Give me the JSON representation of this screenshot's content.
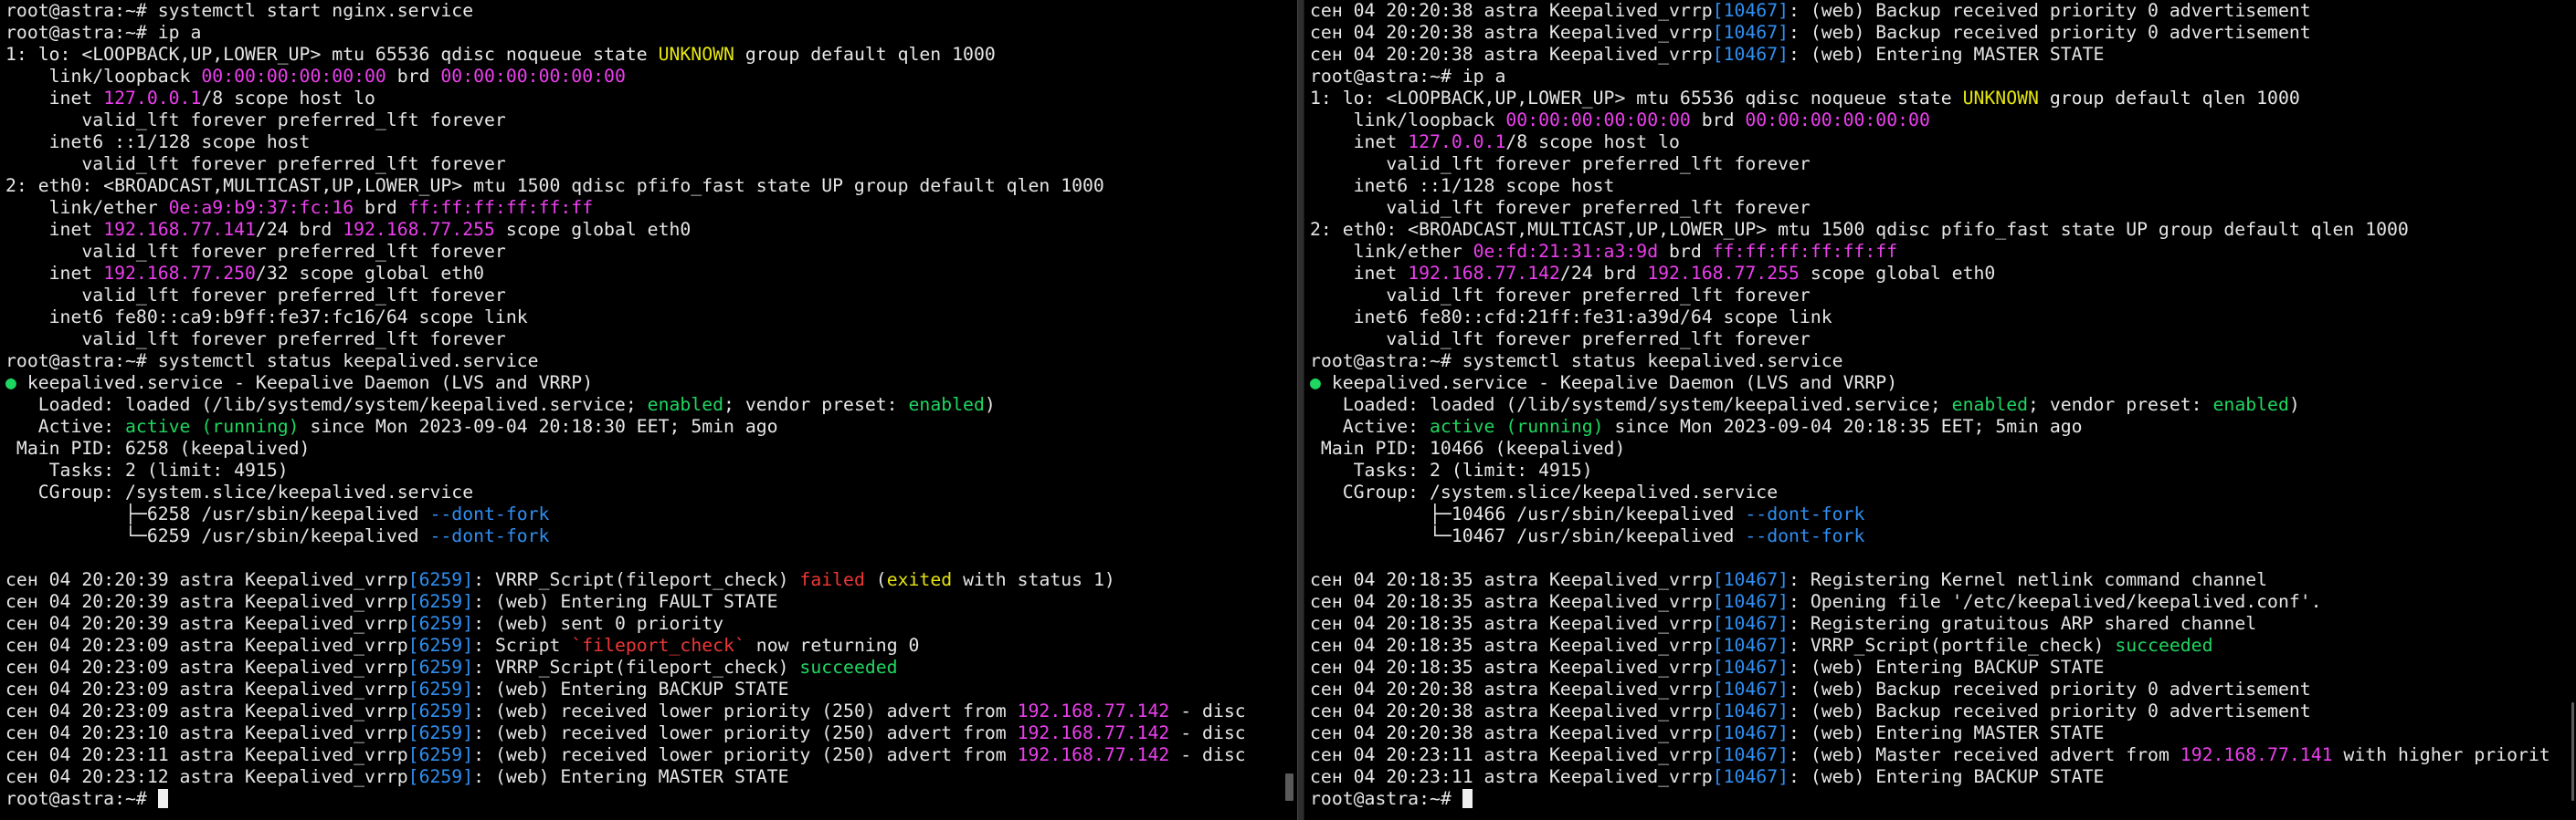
{
  "colors": {
    "default": "#e6e6e6",
    "magenta": "#ec3fee",
    "yellow": "#e5e510",
    "green": "#1ed760",
    "blue": "#2f8ff2",
    "red": "#f03636",
    "background": "#000000"
  },
  "left_pane": {
    "lines": [
      [
        [
          "d",
          "root@astra:~# systemctl start nginx.service"
        ]
      ],
      [
        [
          "d",
          "root@astra:~# ip a"
        ]
      ],
      [
        [
          "d",
          "1: lo: <LOOPBACK,UP,LOWER_UP> mtu 65536 qdisc noqueue state "
        ],
        [
          "y",
          "UNKNOWN"
        ],
        [
          "d",
          " group default qlen 1000"
        ]
      ],
      [
        [
          "d",
          "    link/loopback "
        ],
        [
          "m",
          "00:00:00:00:00:00"
        ],
        [
          "d",
          " brd "
        ],
        [
          "m",
          "00:00:00:00:00:00"
        ]
      ],
      [
        [
          "d",
          "    inet "
        ],
        [
          "m",
          "127.0.0.1"
        ],
        [
          "d",
          "/8 scope host lo"
        ]
      ],
      [
        [
          "d",
          "       valid_lft forever preferred_lft forever"
        ]
      ],
      [
        [
          "d",
          "    inet6 ::1/128 scope host"
        ]
      ],
      [
        [
          "d",
          "       valid_lft forever preferred_lft forever"
        ]
      ],
      [
        [
          "d",
          "2: eth0: <BROADCAST,MULTICAST,UP,LOWER_UP> mtu 1500 qdisc pfifo_fast state UP group default qlen 1000"
        ]
      ],
      [
        [
          "d",
          "    link/ether "
        ],
        [
          "m",
          "0e:a9:b9:37:fc:16"
        ],
        [
          "d",
          " brd "
        ],
        [
          "m",
          "ff:ff:ff:ff:ff:ff"
        ]
      ],
      [
        [
          "d",
          "    inet "
        ],
        [
          "m",
          "192.168.77.141"
        ],
        [
          "d",
          "/24 brd "
        ],
        [
          "m",
          "192.168.77.255"
        ],
        [
          "d",
          " scope global eth0"
        ]
      ],
      [
        [
          "d",
          "       valid_lft forever preferred_lft forever"
        ]
      ],
      [
        [
          "d",
          "    inet "
        ],
        [
          "m",
          "192.168.77.250"
        ],
        [
          "d",
          "/32 scope global eth0"
        ]
      ],
      [
        [
          "d",
          "       valid_lft forever preferred_lft forever"
        ]
      ],
      [
        [
          "d",
          "    inet6 fe80::ca9:b9ff:fe37:fc16/64 scope link"
        ]
      ],
      [
        [
          "d",
          "       valid_lft forever preferred_lft forever"
        ]
      ],
      [
        [
          "d",
          "root@astra:~# systemctl status keepalived.service"
        ]
      ],
      [
        [
          "g",
          "●"
        ],
        [
          "d",
          " keepalived.service - Keepalive Daemon (LVS and VRRP)"
        ]
      ],
      [
        [
          "d",
          "   Loaded: loaded (/lib/systemd/system/keepalived.service; "
        ],
        [
          "g",
          "enabled"
        ],
        [
          "d",
          "; vendor preset: "
        ],
        [
          "g",
          "enabled"
        ],
        [
          "d",
          ")"
        ]
      ],
      [
        [
          "d",
          "   Active: "
        ],
        [
          "g",
          "active (running)"
        ],
        [
          "d",
          " since Mon 2023-09-04 20:18:30 EET; 5min ago"
        ]
      ],
      [
        [
          "d",
          " Main PID: 6258 (keepalived)"
        ]
      ],
      [
        [
          "d",
          "    Tasks: 2 (limit: 4915)"
        ]
      ],
      [
        [
          "d",
          "   CGroup: /system.slice/keepalived.service"
        ]
      ],
      [
        [
          "d",
          "           ├─6258 /usr/sbin/keepalived "
        ],
        [
          "b",
          "--dont-fork"
        ]
      ],
      [
        [
          "d",
          "           └─6259 /usr/sbin/keepalived "
        ],
        [
          "b",
          "--dont-fork"
        ]
      ],
      [
        [
          "d",
          ""
        ]
      ],
      [
        [
          "d",
          "сен 04 20:20:39 astra Keepalived_vrrp"
        ],
        [
          "b",
          "[6259]"
        ],
        [
          "d",
          ": VRRP_Script(fileport_check) "
        ],
        [
          "r",
          "failed"
        ],
        [
          "d",
          " ("
        ],
        [
          "y",
          "exited"
        ],
        [
          "d",
          " with status 1)"
        ]
      ],
      [
        [
          "d",
          "сен 04 20:20:39 astra Keepalived_vrrp"
        ],
        [
          "b",
          "[6259]"
        ],
        [
          "d",
          ": (web) Entering FAULT STATE"
        ]
      ],
      [
        [
          "d",
          "сен 04 20:20:39 astra Keepalived_vrrp"
        ],
        [
          "b",
          "[6259]"
        ],
        [
          "d",
          ": (web) sent 0 priority"
        ]
      ],
      [
        [
          "d",
          "сен 04 20:23:09 astra Keepalived_vrrp"
        ],
        [
          "b",
          "[6259]"
        ],
        [
          "d",
          ": Script "
        ],
        [
          "r",
          "`fileport_check`"
        ],
        [
          "d",
          " now returning 0"
        ]
      ],
      [
        [
          "d",
          "сен 04 20:23:09 astra Keepalived_vrrp"
        ],
        [
          "b",
          "[6259]"
        ],
        [
          "d",
          ": VRRP_Script(fileport_check) "
        ],
        [
          "g",
          "succeeded"
        ]
      ],
      [
        [
          "d",
          "сен 04 20:23:09 astra Keepalived_vrrp"
        ],
        [
          "b",
          "[6259]"
        ],
        [
          "d",
          ": (web) Entering BACKUP STATE"
        ]
      ],
      [
        [
          "d",
          "сен 04 20:23:09 astra Keepalived_vrrp"
        ],
        [
          "b",
          "[6259]"
        ],
        [
          "d",
          ": (web) received lower priority (250) advert from "
        ],
        [
          "m",
          "192.168.77.142"
        ],
        [
          "d",
          " - disc"
        ]
      ],
      [
        [
          "d",
          "сен 04 20:23:10 astra Keepalived_vrrp"
        ],
        [
          "b",
          "[6259]"
        ],
        [
          "d",
          ": (web) received lower priority (250) advert from "
        ],
        [
          "m",
          "192.168.77.142"
        ],
        [
          "d",
          " - disc"
        ]
      ],
      [
        [
          "d",
          "сен 04 20:23:11 astra Keepalived_vrrp"
        ],
        [
          "b",
          "[6259]"
        ],
        [
          "d",
          ": (web) received lower priority (250) advert from "
        ],
        [
          "m",
          "192.168.77.142"
        ],
        [
          "d",
          " - disc"
        ]
      ],
      [
        [
          "d",
          "сен 04 20:23:12 astra Keepalived_vrrp"
        ],
        [
          "b",
          "[6259]"
        ],
        [
          "d",
          ": (web) Entering MASTER STATE"
        ]
      ],
      [
        [
          "d",
          "root@astra:~# "
        ],
        [
          "c",
          ""
        ]
      ]
    ]
  },
  "right_pane": {
    "lines": [
      [
        [
          "d",
          "сен 04 20:20:38 astra Keepalived_vrrp"
        ],
        [
          "b",
          "[10467]"
        ],
        [
          "d",
          ": (web) Backup received priority 0 advertisement"
        ]
      ],
      [
        [
          "d",
          "сен 04 20:20:38 astra Keepalived_vrrp"
        ],
        [
          "b",
          "[10467]"
        ],
        [
          "d",
          ": (web) Backup received priority 0 advertisement"
        ]
      ],
      [
        [
          "d",
          "сен 04 20:20:38 astra Keepalived_vrrp"
        ],
        [
          "b",
          "[10467]"
        ],
        [
          "d",
          ": (web) Entering MASTER STATE"
        ]
      ],
      [
        [
          "d",
          "root@astra:~# ip a"
        ]
      ],
      [
        [
          "d",
          "1: lo: <LOOPBACK,UP,LOWER_UP> mtu 65536 qdisc noqueue state "
        ],
        [
          "y",
          "UNKNOWN"
        ],
        [
          "d",
          " group default qlen 1000"
        ]
      ],
      [
        [
          "d",
          "    link/loopback "
        ],
        [
          "m",
          "00:00:00:00:00:00"
        ],
        [
          "d",
          " brd "
        ],
        [
          "m",
          "00:00:00:00:00:00"
        ]
      ],
      [
        [
          "d",
          "    inet "
        ],
        [
          "m",
          "127.0.0.1"
        ],
        [
          "d",
          "/8 scope host lo"
        ]
      ],
      [
        [
          "d",
          "       valid_lft forever preferred_lft forever"
        ]
      ],
      [
        [
          "d",
          "    inet6 ::1/128 scope host"
        ]
      ],
      [
        [
          "d",
          "       valid_lft forever preferred_lft forever"
        ]
      ],
      [
        [
          "d",
          "2: eth0: <BROADCAST,MULTICAST,UP,LOWER_UP> mtu 1500 qdisc pfifo_fast state UP group default qlen 1000"
        ]
      ],
      [
        [
          "d",
          "    link/ether "
        ],
        [
          "m",
          "0e:fd:21:31:a3:9d"
        ],
        [
          "d",
          " brd "
        ],
        [
          "m",
          "ff:ff:ff:ff:ff:ff"
        ]
      ],
      [
        [
          "d",
          "    inet "
        ],
        [
          "m",
          "192.168.77.142"
        ],
        [
          "d",
          "/24 brd "
        ],
        [
          "m",
          "192.168.77.255"
        ],
        [
          "d",
          " scope global eth0"
        ]
      ],
      [
        [
          "d",
          "       valid_lft forever preferred_lft forever"
        ]
      ],
      [
        [
          "d",
          "    inet6 fe80::cfd:21ff:fe31:a39d/64 scope link"
        ]
      ],
      [
        [
          "d",
          "       valid_lft forever preferred_lft forever"
        ]
      ],
      [
        [
          "d",
          "root@astra:~# systemctl status keepalived.service"
        ]
      ],
      [
        [
          "g",
          "●"
        ],
        [
          "d",
          " keepalived.service - Keepalive Daemon (LVS and VRRP)"
        ]
      ],
      [
        [
          "d",
          "   Loaded: loaded (/lib/systemd/system/keepalived.service; "
        ],
        [
          "g",
          "enabled"
        ],
        [
          "d",
          "; vendor preset: "
        ],
        [
          "g",
          "enabled"
        ],
        [
          "d",
          ")"
        ]
      ],
      [
        [
          "d",
          "   Active: "
        ],
        [
          "g",
          "active (running)"
        ],
        [
          "d",
          " since Mon 2023-09-04 20:18:35 EET; 5min ago"
        ]
      ],
      [
        [
          "d",
          " Main PID: 10466 (keepalived)"
        ]
      ],
      [
        [
          "d",
          "    Tasks: 2 (limit: 4915)"
        ]
      ],
      [
        [
          "d",
          "   CGroup: /system.slice/keepalived.service"
        ]
      ],
      [
        [
          "d",
          "           ├─10466 /usr/sbin/keepalived "
        ],
        [
          "b",
          "--dont-fork"
        ]
      ],
      [
        [
          "d",
          "           └─10467 /usr/sbin/keepalived "
        ],
        [
          "b",
          "--dont-fork"
        ]
      ],
      [
        [
          "d",
          ""
        ]
      ],
      [
        [
          "d",
          "сен 04 20:18:35 astra Keepalived_vrrp"
        ],
        [
          "b",
          "[10467]"
        ],
        [
          "d",
          ": Registering Kernel netlink command channel"
        ]
      ],
      [
        [
          "d",
          "сен 04 20:18:35 astra Keepalived_vrrp"
        ],
        [
          "b",
          "[10467]"
        ],
        [
          "d",
          ": Opening file '/etc/keepalived/keepalived.conf'."
        ]
      ],
      [
        [
          "d",
          "сен 04 20:18:35 astra Keepalived_vrrp"
        ],
        [
          "b",
          "[10467]"
        ],
        [
          "d",
          ": Registering gratuitous ARP shared channel"
        ]
      ],
      [
        [
          "d",
          "сен 04 20:18:35 astra Keepalived_vrrp"
        ],
        [
          "b",
          "[10467]"
        ],
        [
          "d",
          ": VRRP_Script(portfile_check) "
        ],
        [
          "g",
          "succeeded"
        ]
      ],
      [
        [
          "d",
          "сен 04 20:18:35 astra Keepalived_vrrp"
        ],
        [
          "b",
          "[10467]"
        ],
        [
          "d",
          ": (web) Entering BACKUP STATE"
        ]
      ],
      [
        [
          "d",
          "сен 04 20:20:38 astra Keepalived_vrrp"
        ],
        [
          "b",
          "[10467]"
        ],
        [
          "d",
          ": (web) Backup received priority 0 advertisement"
        ]
      ],
      [
        [
          "d",
          "сен 04 20:20:38 astra Keepalived_vrrp"
        ],
        [
          "b",
          "[10467]"
        ],
        [
          "d",
          ": (web) Backup received priority 0 advertisement"
        ]
      ],
      [
        [
          "d",
          "сен 04 20:20:38 astra Keepalived_vrrp"
        ],
        [
          "b",
          "[10467]"
        ],
        [
          "d",
          ": (web) Entering MASTER STATE"
        ]
      ],
      [
        [
          "d",
          "сен 04 20:23:11 astra Keepalived_vrrp"
        ],
        [
          "b",
          "[10467]"
        ],
        [
          "d",
          ": (web) Master received advert from "
        ],
        [
          "m",
          "192.168.77.141"
        ],
        [
          "d",
          " with higher priorit"
        ]
      ],
      [
        [
          "d",
          "сен 04 20:23:11 astra Keepalived_vrrp"
        ],
        [
          "b",
          "[10467]"
        ],
        [
          "d",
          ": (web) Entering BACKUP STATE"
        ]
      ],
      [
        [
          "d",
          "root@astra:~# "
        ],
        [
          "c",
          ""
        ]
      ]
    ]
  }
}
